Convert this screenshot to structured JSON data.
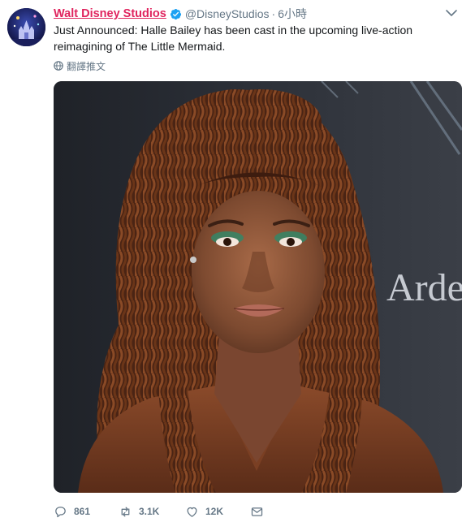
{
  "tweet": {
    "author_name": "Walt Disney Studios",
    "handle": "@DisneyStudios",
    "separator": "·",
    "time": "6小時",
    "text": "Just Announced: Halle Bailey has been cast in the upcoming live-action reimagining of The Little Mermaid.",
    "translate_label": "翻譯推文",
    "background_sign_text": "Arden"
  },
  "actions": {
    "reply_count": "861",
    "retweet_count": "3.1K",
    "like_count": "12K"
  },
  "colors": {
    "name": "#e0245e",
    "verified": "#1da1f2",
    "muted": "#657786",
    "text": "#14171a"
  }
}
